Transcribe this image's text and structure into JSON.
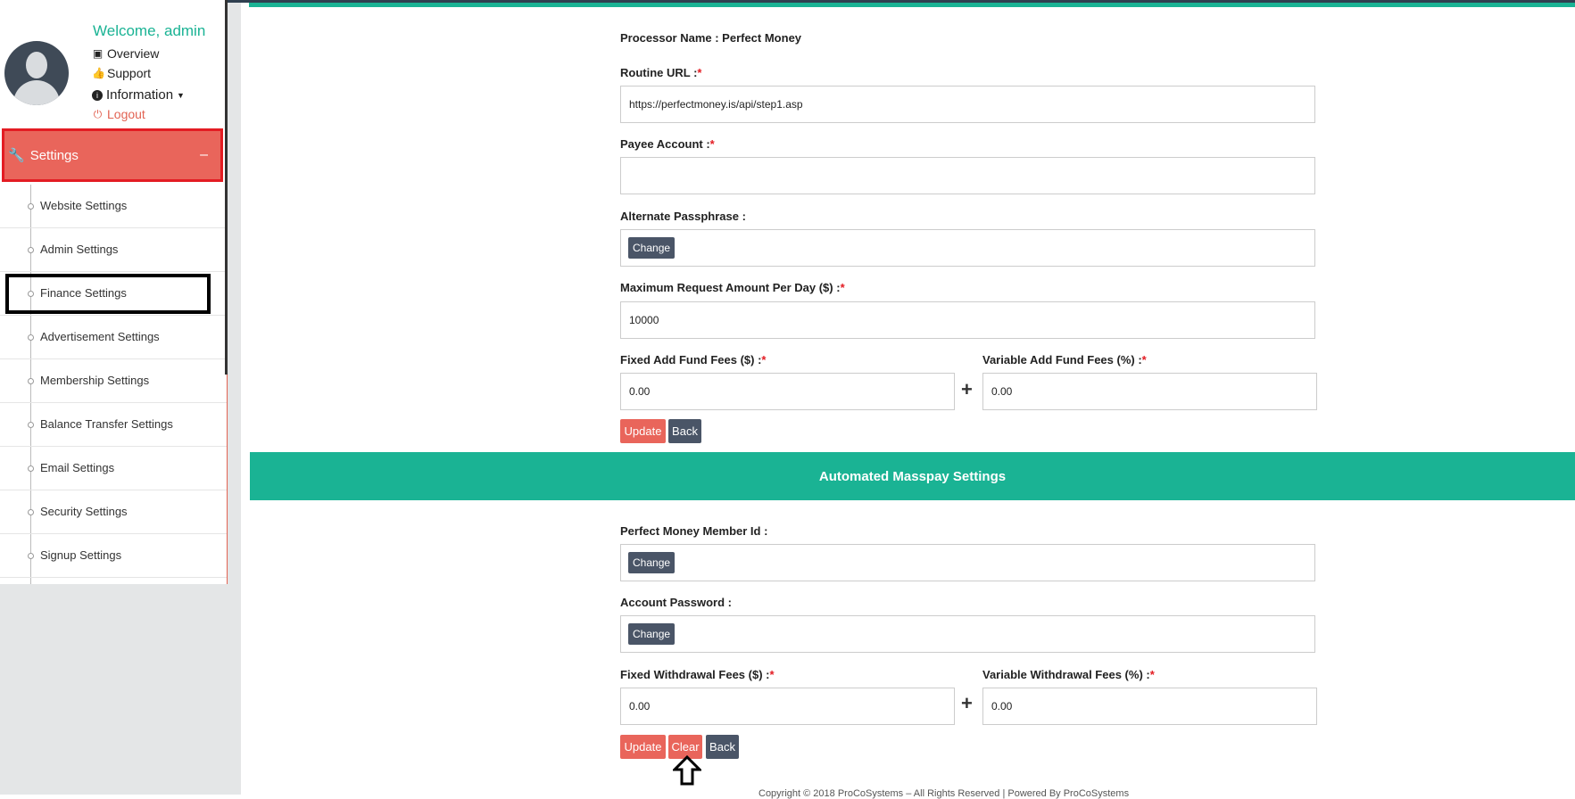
{
  "user": {
    "welcome": "Welcome, admin",
    "links": [
      {
        "label": "Overview",
        "icon": "image-icon"
      },
      {
        "label": "Support",
        "icon": "thumbs-up-icon"
      },
      {
        "label": "Information",
        "icon": "info-icon"
      },
      {
        "label": "Logout",
        "icon": "power-icon"
      }
    ]
  },
  "sidebar": {
    "section_title": "Settings",
    "collapse_symbol": "–",
    "items": [
      {
        "label": "Website Settings"
      },
      {
        "label": "Admin Settings"
      },
      {
        "label": "Finance Settings"
      },
      {
        "label": "Advertisement Settings"
      },
      {
        "label": "Membership Settings"
      },
      {
        "label": "Balance Transfer Settings"
      },
      {
        "label": "Email Settings"
      },
      {
        "label": "Security Settings"
      },
      {
        "label": "Signup Settings"
      }
    ]
  },
  "processor": {
    "name_label": "Processor Name : Perfect Money",
    "routine_url_label": "Routine URL :",
    "routine_url_value": "https://perfectmoney.is/api/step1.asp",
    "payee_account_label": "Payee Account :",
    "payee_account_value": "",
    "alt_passphrase_label": "Alternate Passphrase :",
    "change_label": "Change",
    "max_request_label": "Maximum Request Amount Per Day ($) :",
    "max_request_value": "10000",
    "fixed_fund_fee_label": "Fixed Add Fund Fees ($) :",
    "fixed_fund_fee_value": "0.00",
    "variable_fund_fee_label": "Variable Add Fund Fees (%) :",
    "variable_fund_fee_value": "0.00",
    "update_label": "Update",
    "back_label": "Back"
  },
  "masspay": {
    "title": "Automated Masspay Settings",
    "member_id_label": "Perfect Money Member Id :",
    "account_password_label": "Account Password :",
    "change_label": "Change",
    "fixed_withdraw_label": "Fixed Withdrawal Fees ($) :",
    "fixed_withdraw_value": "0.00",
    "variable_withdraw_label": "Variable Withdrawal Fees (%) :",
    "variable_withdraw_value": "0.00",
    "update_label": "Update",
    "clear_label": "Clear",
    "back_label": "Back"
  },
  "required_mark": "*",
  "plus_symbol": "+",
  "footer": "Copyright © 2018 ProCoSystems – All Rights Reserved | Powered By ProCoSystems",
  "colors": {
    "accent": "#1ab394",
    "danger": "#e9655b",
    "dark": "#4a5567",
    "highlight_border": "#e31c23"
  }
}
